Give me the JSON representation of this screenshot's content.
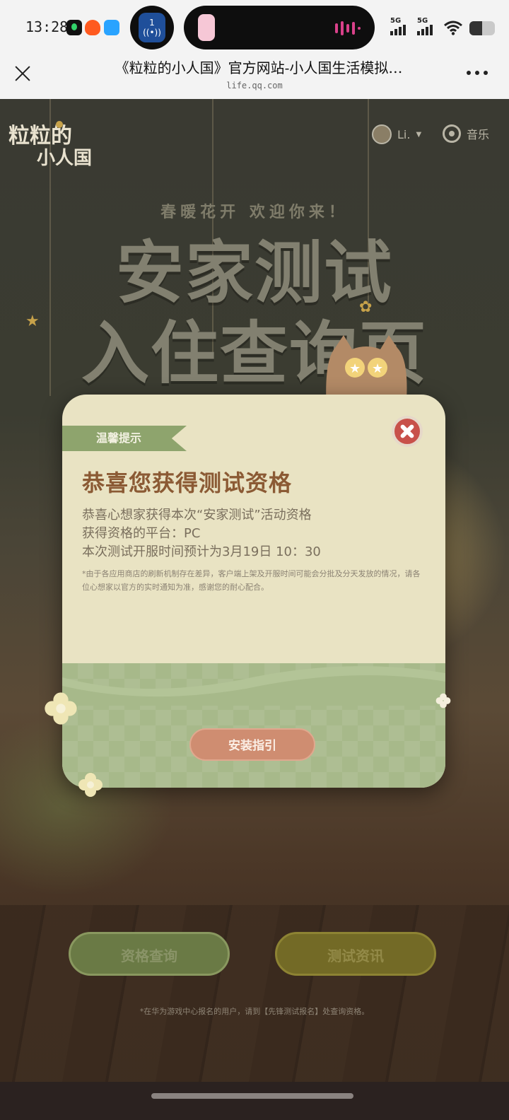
{
  "status_bar": {
    "time": "13:28",
    "hotspot_count": "1",
    "signal_1": "5G",
    "signal_2": "5G"
  },
  "browser": {
    "title": "《粒粒的小人国》官方网站-小人国生活模拟…",
    "domain": "life.qq.com"
  },
  "page": {
    "logo_line1": "粒粒的",
    "logo_line2": "小人国",
    "user_name": "Li.",
    "music_label": "音乐",
    "slogan": "春暖花开  欢迎你来！",
    "hero_line1": "安家测试",
    "hero_line2": "入住查询页"
  },
  "modal": {
    "ribbon": "温馨提示",
    "heading": "恭喜您获得测试资格",
    "lines": [
      "恭喜心想家获得本次“安家测试”活动资格",
      "获得资格的平台：PC",
      "本次测试开服时间预计为3月19日 10：30"
    ],
    "note": "*由于各应用商店的刷新机制存在差异，客户端上架及开服时间可能会分批及分天发放的情况，请各位心想家以官方的实时通知为准，感谢您的耐心配合。",
    "install_button": "安装指引"
  },
  "bottom": {
    "qualification_button": "资格查询",
    "news_button": "测试资讯",
    "footer_note": "*在华为游戏中心报名的用户，请到【先锋测试报名】处查询资格。"
  },
  "colors": {
    "modal_bg": "#e9e3c3",
    "modal_green": "#a7b98a",
    "ribbon": "#8ea46d",
    "heading": "#8b5a34",
    "close": "#c8514a",
    "install": "#cf8d71"
  },
  "icons": [
    "close-icon",
    "more-icon",
    "music-icon",
    "avatar",
    "modal-close-icon",
    "cat-mascot",
    "flower-icon"
  ]
}
